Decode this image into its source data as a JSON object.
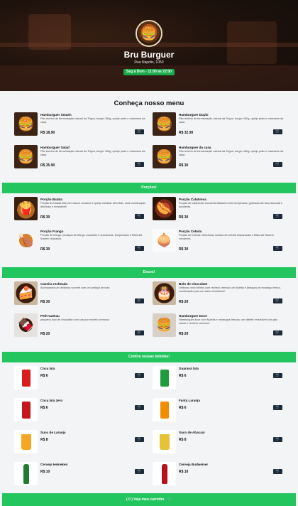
{
  "header": {
    "brand": "Bru Burguer",
    "address": "Rua Napolis, 1050",
    "hours": "Seg à Dom - 11:00 as 22:00"
  },
  "menu_title": "Conheça nosso menu",
  "burgers": [
    {
      "name": "Hamburguer Smash",
      "desc": "Pão levinho de fermentação natural da Trigou, burger 160g, queijo prato e maionese da casa.",
      "price": "R$ 18.90",
      "icon": "burger-image"
    },
    {
      "name": "Hamburguer Duplo",
      "desc": "Pão levinho de fermentação natural da Trigou, burger 160g, queijo prato e maionese da casa.",
      "price": "R$ 32.90",
      "icon": "burger-image"
    },
    {
      "name": "Hamburguer Salad",
      "desc": "Pão levinho de fermentação natural da Trigou, burger 160g, queijo prato e maionese da casa.",
      "price": "R$ 35.90",
      "icon": "burger-image"
    },
    {
      "name": "Hamburguer da casa",
      "desc": "Pão levinho de fermentação natural da Trigou, burger 160g, queijo prato e maionese da casa.",
      "price": "R$ 30",
      "icon": "burger-image"
    }
  ],
  "portions_title": "Porções!",
  "portions": [
    {
      "name": "Porção Batata",
      "desc": "Porção de batata frita com bacon crocante e queijo cheddar derretido: uma combinação deliciosa e irresistível!",
      "price": "R$ 30",
      "icon": "fries-image"
    },
    {
      "name": "Porção Calabresa",
      "desc": "Porção de calabresa: suculenta fatiada e bem temperada, grelhada até ficar dourada e suculenta.",
      "price": "R$ 30",
      "icon": "sausage-image"
    },
    {
      "name": "Porção Frango",
      "desc": "Porção de frango: pedaços de frango crocantes e suculentos, temperados e fritos até ficarem dourados.",
      "price": "R$ 30",
      "icon": "chicken-image"
    },
    {
      "name": "Porção Cebola",
      "desc": "Porção de Cebola: Deliciosas rodelas de cebola empanadas e fritas até ficarem crocantes.",
      "price": "R$ 30",
      "icon": "onion-rings-image"
    }
  ],
  "desserts_title": "Doces!",
  "desserts": [
    {
      "name": "Caveira recheada",
      "desc": "Acompanha um delicioso sorvete com um pedaço de bolo",
      "price": "R$ 30",
      "icon": "cake-image"
    },
    {
      "name": "Bolo de Chocolate",
      "desc": "Delicioso bolo fofinho com recheio cremoso de Nutella e pedaços de morango fresco, combinação para um sabor irresistível!",
      "price": "R$ 20",
      "icon": "chocolate-cake-image"
    },
    {
      "name": "Petit Gateau",
      "desc": "pequeno bolo de chocolate com casca e recheio cremoso",
      "price": "R$ 20",
      "icon": "petit-gateau-image"
    },
    {
      "name": "Hamburguer Doce",
      "desc": "Hamburguer doce com Nutella e morangos frescos: um deleite irresistível com pão macio e recheio cremoso!",
      "price": "R$ 20",
      "icon": "sweet-burger-image"
    }
  ],
  "drinks_title": "Confira nossas bebidas!",
  "drinks": [
    {
      "name": "Coca lata",
      "price": "R$ 6",
      "icon": "coca-cola-can-image",
      "color": "#d81e1e"
    },
    {
      "name": "Guaraná lata",
      "price": "R$ 6",
      "icon": "guarana-can-image",
      "color": "#1f9d3a"
    },
    {
      "name": "Coca lata zero",
      "price": "R$ 6",
      "icon": "coca-zero-can-image",
      "color": "#c4161c"
    },
    {
      "name": "Fanta Laranja",
      "price": "R$ 6",
      "icon": "fanta-can-image",
      "color": "#f28c00"
    },
    {
      "name": "Suco de Laranja",
      "price": "R$ 8",
      "icon": "orange-juice-image",
      "color": "#f5a623"
    },
    {
      "name": "Suco de Abacaxi",
      "price": "R$ 8",
      "icon": "pineapple-juice-image",
      "color": "#e5c236"
    },
    {
      "name": "Cerveja Heineken",
      "price": "R$ 10",
      "icon": "heineken-bottle-image",
      "color": "#1e7d32"
    },
    {
      "name": "Cerveja Budweiser",
      "price": "R$ 10",
      "icon": "budweiser-bottle-image",
      "color": "#b5121b"
    }
  ],
  "footer": {
    "cart_label": "( 0 ) Veja meu carrinho",
    "cart_icon": "cart-icon"
  }
}
